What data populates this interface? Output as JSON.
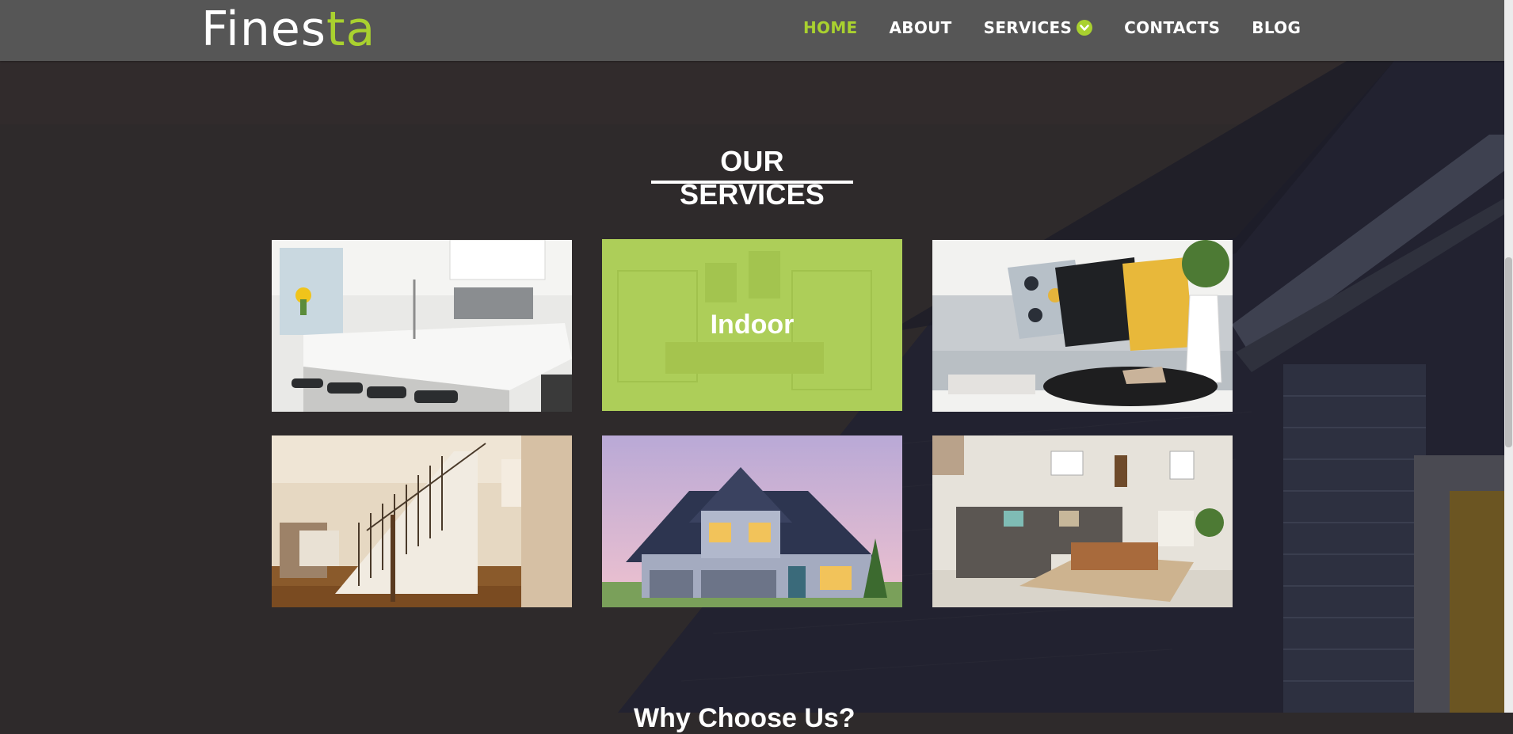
{
  "logo": {
    "text_main": "Fines",
    "text_accent": "ta"
  },
  "nav": {
    "items": [
      {
        "label": "HOME",
        "active": true
      },
      {
        "label": "ABOUT",
        "active": false
      },
      {
        "label": "SERVICES",
        "active": false,
        "has_dropdown": true
      },
      {
        "label": "CONTACTS",
        "active": false
      },
      {
        "label": "BLOG",
        "active": false
      }
    ]
  },
  "services": {
    "title": "OUR SERVICES",
    "cards": [
      {
        "image": "kitchen-interior",
        "hover_label": ""
      },
      {
        "image": "indoor-room",
        "hover_label": "Indoor"
      },
      {
        "image": "living-room-cushions",
        "hover_label": ""
      },
      {
        "image": "staircase-interior",
        "hover_label": ""
      },
      {
        "image": "house-exterior",
        "hover_label": ""
      },
      {
        "image": "living-room-sofa",
        "hover_label": ""
      }
    ]
  },
  "next_section": {
    "title": "Why Choose Us?"
  },
  "colors": {
    "accent": "#a9d12f",
    "header_bg": "#565656",
    "page_bg": "#2e2a2b",
    "overlay": "#a8ce4c"
  }
}
